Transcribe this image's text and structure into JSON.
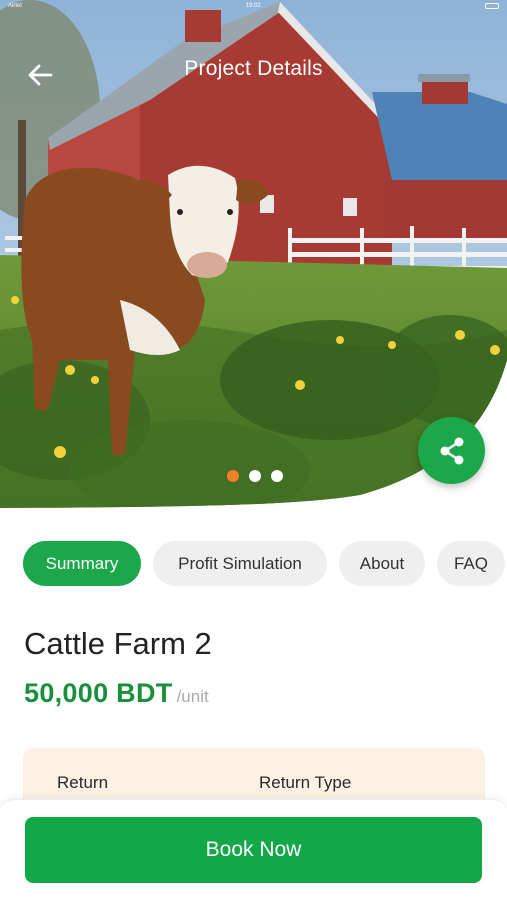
{
  "status_bar": {
    "time": "19:02",
    "carrier": "Airtel"
  },
  "header": {
    "title": "Project Details",
    "back_icon": "arrow-left-icon",
    "share_icon": "share-icon"
  },
  "carousel": {
    "slide_count": 3,
    "active_index": 0,
    "active_color": "#f0802a"
  },
  "tabs": [
    {
      "label": "Summary",
      "active": true
    },
    {
      "label": "Profit Simulation",
      "active": false
    },
    {
      "label": "About",
      "active": false
    },
    {
      "label": "FAQ",
      "active": false
    }
  ],
  "project": {
    "name": "Cattle Farm 2",
    "price": "50,000 BDT",
    "unit": "/unit"
  },
  "info_card": {
    "return_label": "Return",
    "return_type_label": "Return Type"
  },
  "cta": {
    "book_label": "Book Now"
  },
  "colors": {
    "accent": "#1ca84a",
    "price": "#1a8f3c",
    "card_bg": "#fdf1e4"
  }
}
